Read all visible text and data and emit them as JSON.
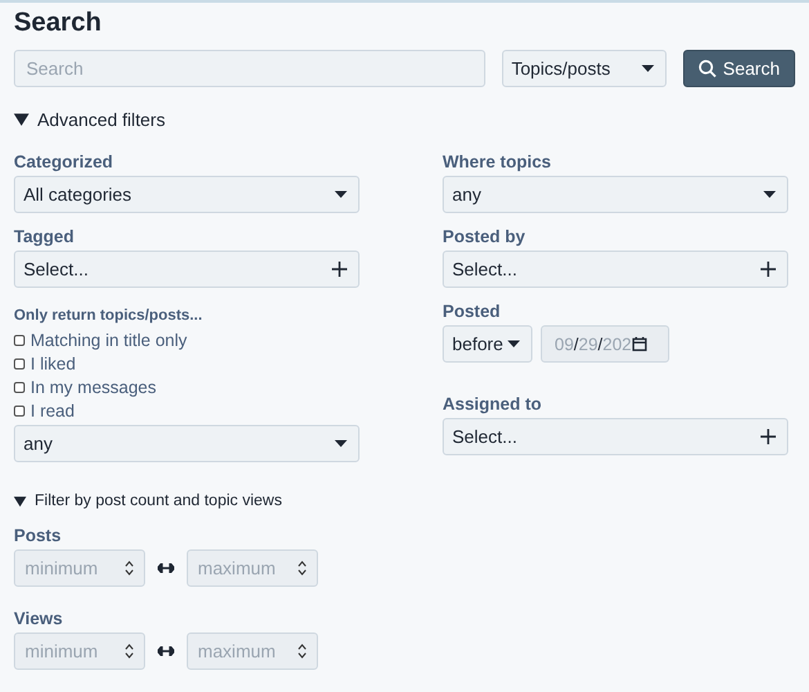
{
  "title": "Search",
  "search": {
    "placeholder": "Search",
    "scope": "Topics/posts",
    "button": "Search"
  },
  "advanced": {
    "label": "Advanced filters",
    "expanded": true
  },
  "categorized": {
    "label": "Categorized",
    "value": "All categories"
  },
  "tagged": {
    "label": "Tagged",
    "value": "Select..."
  },
  "only_return": {
    "label": "Only return topics/posts...",
    "options": [
      {
        "label": "Matching in title only",
        "checked": false
      },
      {
        "label": "I liked",
        "checked": false
      },
      {
        "label": "In my messages",
        "checked": false
      },
      {
        "label": "I read",
        "checked": false
      }
    ],
    "value": "any"
  },
  "where_topics": {
    "label": "Where topics",
    "value": "any"
  },
  "posted_by": {
    "label": "Posted by",
    "value": "Select..."
  },
  "posted": {
    "label": "Posted",
    "relation": "before",
    "date": [
      "09",
      "29",
      "202"
    ],
    "separator": "/"
  },
  "assigned_to": {
    "label": "Assigned to",
    "value": "Select..."
  },
  "count_filter": {
    "label": "Filter by post count and topic views",
    "expanded": true,
    "ranges": [
      {
        "label": "Posts",
        "min_placeholder": "minimum",
        "max_placeholder": "maximum"
      },
      {
        "label": "Views",
        "min_placeholder": "minimum",
        "max_placeholder": "maximum"
      }
    ]
  }
}
